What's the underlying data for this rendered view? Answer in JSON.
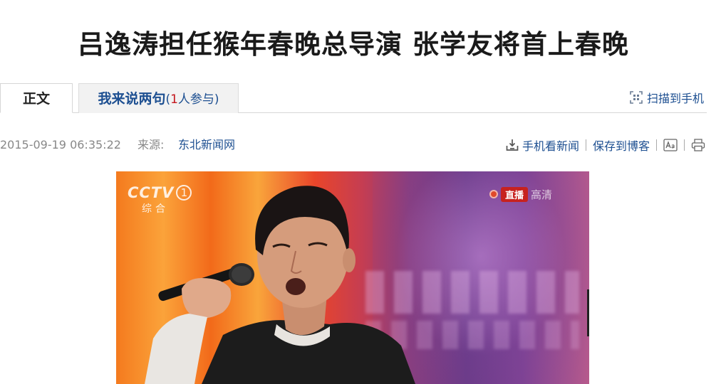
{
  "article": {
    "title": "吕逸涛担任猴年春晚总导演 张学友将首上春晚"
  },
  "tabs": {
    "main_label": "正文",
    "comment_label": "我来说两句",
    "comment_open": "(",
    "comment_count": "1",
    "comment_suffix": "人参与)"
  },
  "scan": {
    "label": "扫描到手机",
    "icon": "qr-scan-icon"
  },
  "meta": {
    "date": "2015-09-19 06:35:22",
    "source_label": "来源:",
    "source": "东北新闻网"
  },
  "tools": {
    "mobile_label": "手机看新闻",
    "save_label": "保存到博客",
    "font_icon": "font-size-icon",
    "print_icon": "print-icon"
  },
  "photo": {
    "channel_logo": "CCTV",
    "channel_number": "1",
    "channel_sub": "综合",
    "live_label": "直播",
    "hd_label": "高清"
  },
  "colors": {
    "link": "#1d4f91",
    "accent_red": "#c4161c",
    "meta_gray": "#888888"
  }
}
